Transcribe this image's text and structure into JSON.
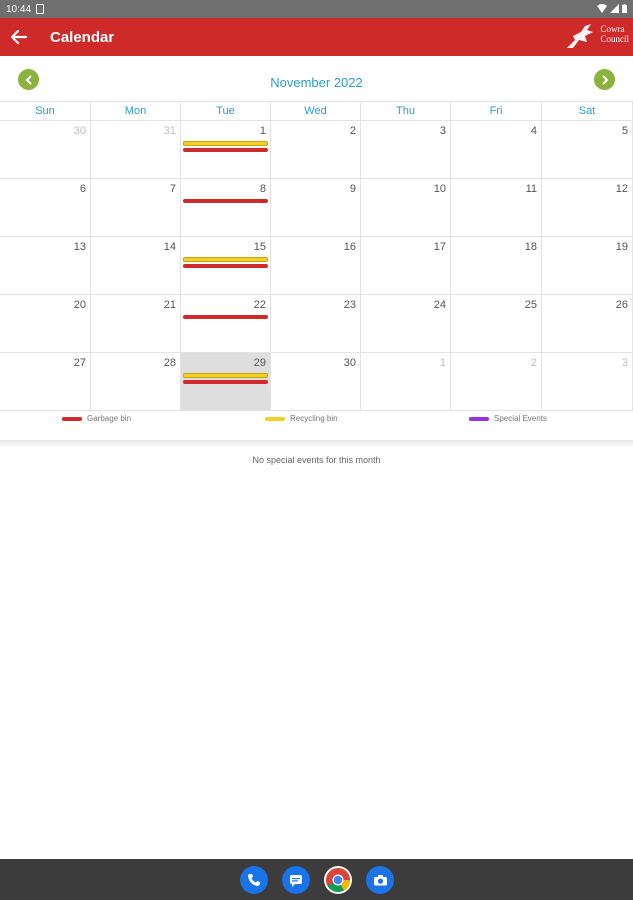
{
  "status_bar": {
    "time": "10:44"
  },
  "app_bar": {
    "title": "Calendar",
    "logo_line1": "Cowra",
    "logo_line2": "Council"
  },
  "calendar": {
    "month_title": "November 2022",
    "weekdays": [
      "Sun",
      "Mon",
      "Tue",
      "Wed",
      "Thu",
      "Fri",
      "Sat"
    ],
    "weeks": [
      [
        {
          "n": "30",
          "other": true
        },
        {
          "n": "31",
          "other": true
        },
        {
          "n": "1",
          "events": [
            "recycle",
            "garbage"
          ]
        },
        {
          "n": "2"
        },
        {
          "n": "3"
        },
        {
          "n": "4"
        },
        {
          "n": "5"
        }
      ],
      [
        {
          "n": "6"
        },
        {
          "n": "7"
        },
        {
          "n": "8",
          "events": [
            "garbage"
          ]
        },
        {
          "n": "9"
        },
        {
          "n": "10"
        },
        {
          "n": "11"
        },
        {
          "n": "12"
        }
      ],
      [
        {
          "n": "13"
        },
        {
          "n": "14"
        },
        {
          "n": "15",
          "events": [
            "recycle",
            "garbage"
          ]
        },
        {
          "n": "16"
        },
        {
          "n": "17"
        },
        {
          "n": "18"
        },
        {
          "n": "19"
        }
      ],
      [
        {
          "n": "20"
        },
        {
          "n": "21"
        },
        {
          "n": "22",
          "events": [
            "garbage"
          ]
        },
        {
          "n": "23"
        },
        {
          "n": "24"
        },
        {
          "n": "25"
        },
        {
          "n": "26"
        }
      ],
      [
        {
          "n": "27"
        },
        {
          "n": "28"
        },
        {
          "n": "29",
          "today": true,
          "events": [
            "recycle",
            "garbage"
          ]
        },
        {
          "n": "30"
        },
        {
          "n": "1",
          "other": true
        },
        {
          "n": "2",
          "other": true
        },
        {
          "n": "3",
          "other": true
        }
      ]
    ]
  },
  "legend": [
    {
      "label": "Garbage bin",
      "color": "#d12a2a"
    },
    {
      "label": "Recycling bin",
      "color": "#f3cf2c"
    },
    {
      "label": "Special Events",
      "color": "#9b2fd8"
    }
  ],
  "events_message": "No special events for this month",
  "dock": [
    {
      "name": "phone-icon",
      "color": "#1a73e8"
    },
    {
      "name": "messages-icon",
      "color": "#1a73e8"
    },
    {
      "name": "chrome-icon",
      "color": "#ffffff"
    },
    {
      "name": "camera-icon",
      "color": "#1a73e8"
    }
  ],
  "colors": {
    "brand_red": "#cf2a2a",
    "accent_blue": "#2a9fd0",
    "nav_green": "#8bb23d"
  }
}
